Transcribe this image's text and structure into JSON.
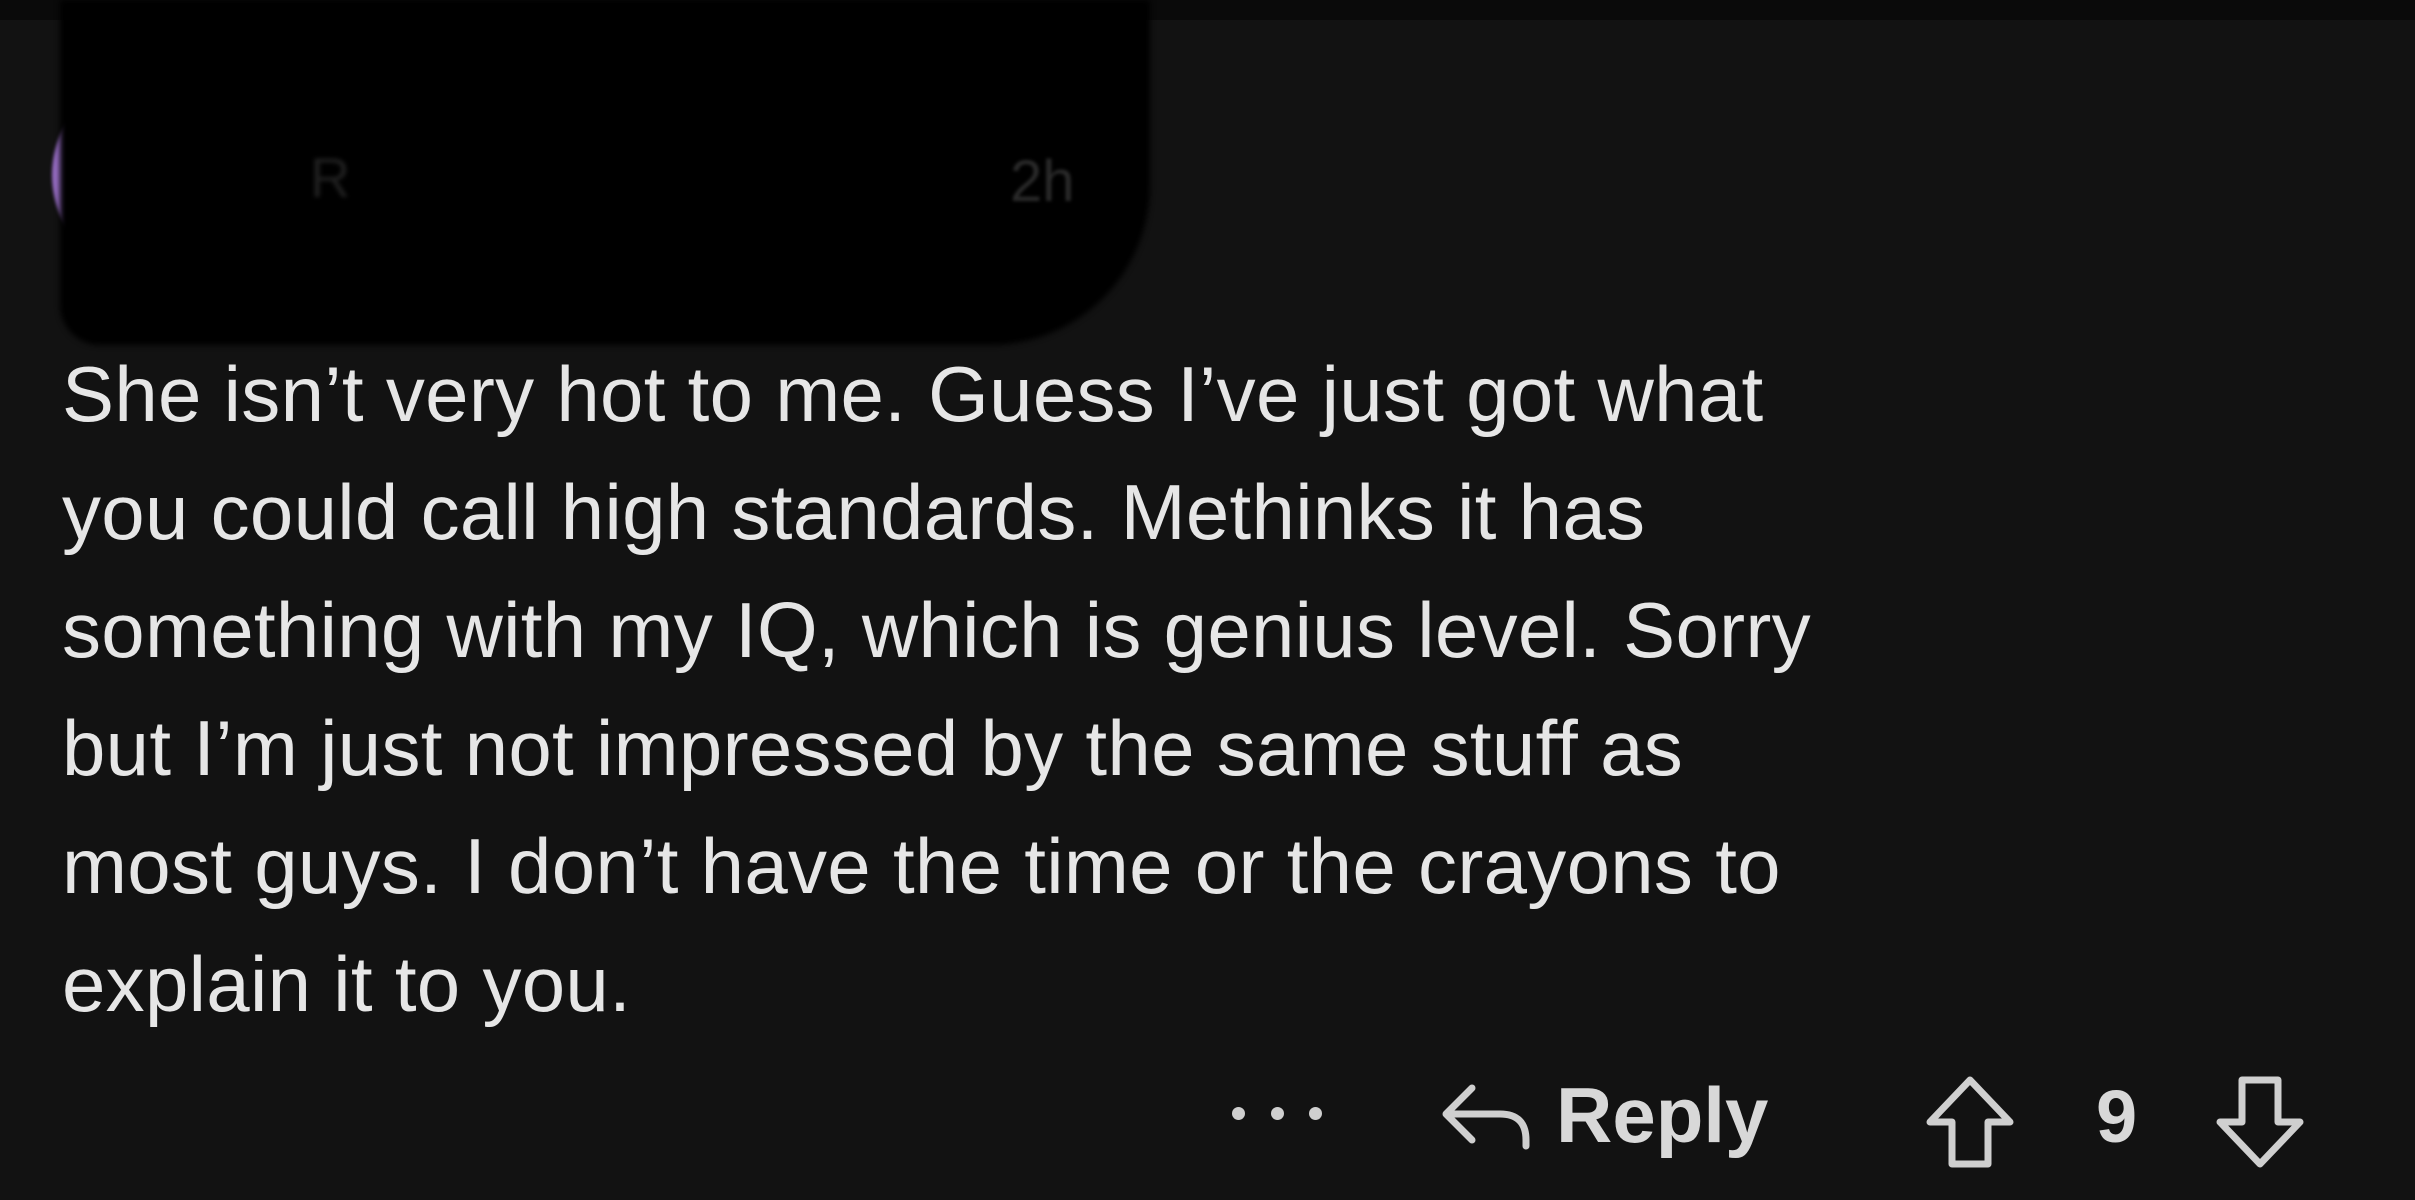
{
  "comment": {
    "author": "R",
    "timestamp": "2h",
    "body_lines": [
      "She isn’t very hot to me. Guess I’ve just got what",
      "you could call high standards. Methinks it has",
      "something with my IQ, which is genius level. Sorry",
      "but I’m just not impressed by the same stuff as",
      "most guys. I don’t have the time or the crayons to",
      "explain it to you."
    ]
  },
  "actions": {
    "more_icon": "ellipsis-icon",
    "reply_icon": "reply-arrow-icon",
    "reply_label": "Reply",
    "upvote_icon": "upvote-arrow-icon",
    "score": "9",
    "downvote_icon": "downvote-arrow-icon"
  },
  "colors": {
    "background": "#121212",
    "text": "#e6e6e6",
    "avatar": "#a277d0"
  }
}
